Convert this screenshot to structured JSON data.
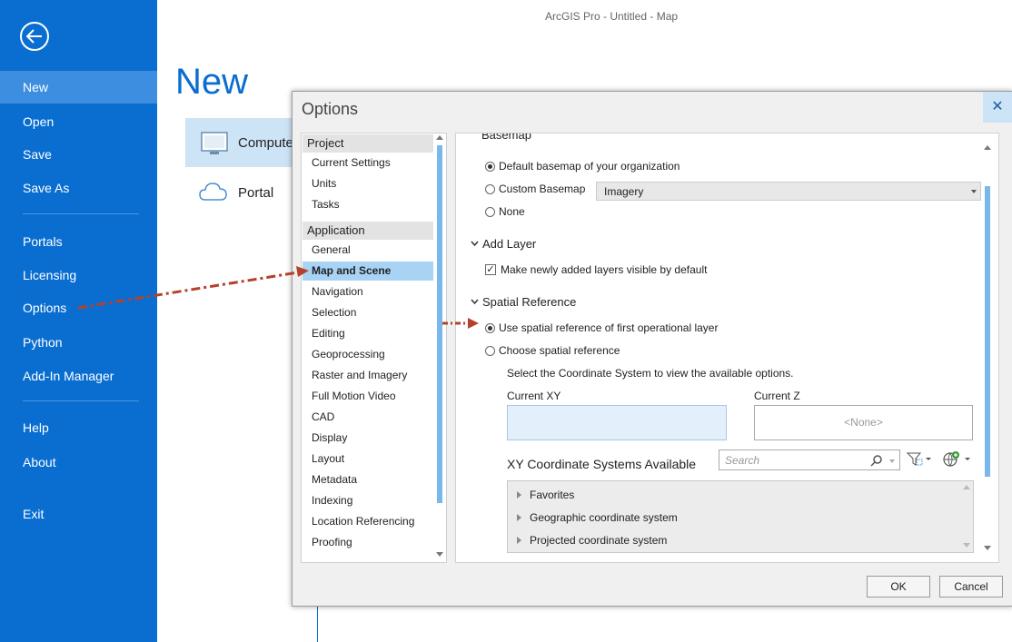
{
  "window": {
    "title": "ArcGIS Pro - Untitled - Map"
  },
  "sidebar": {
    "items": [
      {
        "label": "New"
      },
      {
        "label": "Open"
      },
      {
        "label": "Save"
      },
      {
        "label": "Save As"
      },
      {
        "label": "Portals"
      },
      {
        "label": "Licensing"
      },
      {
        "label": "Options"
      },
      {
        "label": "Python"
      },
      {
        "label": "Add-In Manager"
      },
      {
        "label": "Help"
      },
      {
        "label": "About"
      },
      {
        "label": "Exit"
      }
    ],
    "active": "New",
    "back_icon": "back-arrow-icon"
  },
  "backstage": {
    "heading": "New",
    "tiles": [
      {
        "label": "Compute",
        "icon": "computer-icon"
      },
      {
        "label": "Portal",
        "icon": "cloud-icon"
      }
    ]
  },
  "dialog": {
    "title": "Options",
    "close_label": "✕",
    "categories": {
      "project_header": "Project",
      "project_items": [
        "Current Settings",
        "Units",
        "Tasks"
      ],
      "application_header": "Application",
      "application_items": [
        "General",
        "Map and Scene",
        "Navigation",
        "Selection",
        "Editing",
        "Geoprocessing",
        "Raster and Imagery",
        "Full Motion Video",
        "CAD",
        "Display",
        "Layout",
        "Metadata",
        "Indexing",
        "Location Referencing",
        "Proofing"
      ],
      "selected": "Map and Scene"
    },
    "settings": {
      "basemap_section": "Basemap",
      "basemap_options": [
        "Default basemap of your organization",
        "Custom Basemap",
        "None"
      ],
      "basemap_selected": "Default basemap of your organization",
      "custom_basemap_value": "Imagery",
      "add_layer_section": "Add Layer",
      "add_layer_checkbox": "Make newly added layers visible by default",
      "add_layer_checked": true,
      "spatial_ref_section": "Spatial Reference",
      "spatial_ref_options": [
        "Use spatial reference of first operational layer",
        "Choose spatial reference"
      ],
      "spatial_ref_selected": "Use spatial reference of first operational layer",
      "coord_hint": "Select the Coordinate System to view the available options.",
      "current_xy_label": "Current XY",
      "current_z_label": "Current Z",
      "current_z_value": "<None>",
      "xy_available_label": "XY Coordinate Systems Available",
      "search_placeholder": "Search",
      "tree_items": [
        "Favorites",
        "Geographic coordinate system",
        "Projected coordinate system"
      ]
    },
    "ok_label": "OK",
    "cancel_label": "Cancel"
  },
  "colors": {
    "sidebar": "#0a6ed1",
    "accent": "#7ab8eb",
    "arrow": "#b5412c",
    "selected": "#a8d3f5"
  }
}
